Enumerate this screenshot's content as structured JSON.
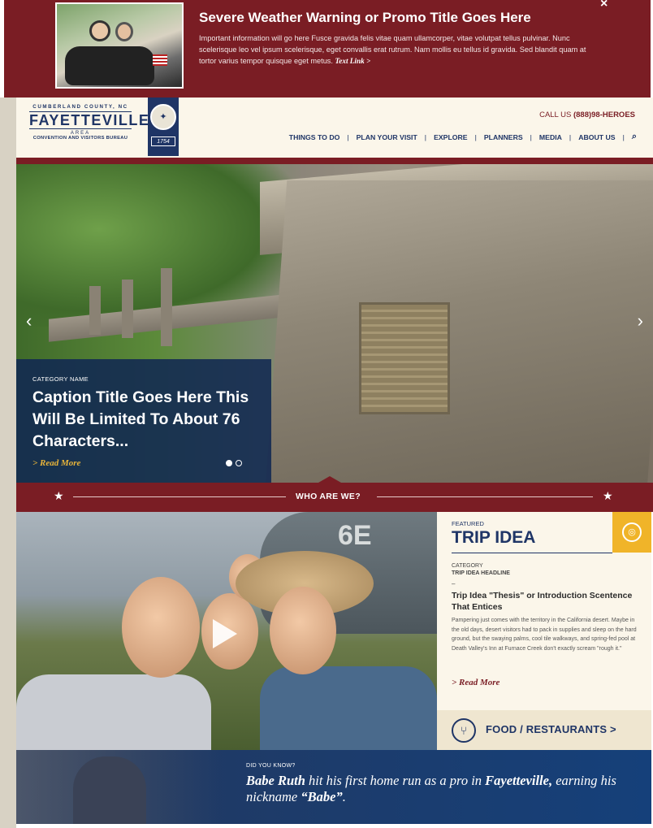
{
  "alert": {
    "title": "Severe Weather Warning or Promo Title Goes Here",
    "body": "Important information will go here Fusce gravida felis vitae quam ullamcorper, vitae volutpat tellus pulvinar. Nunc scelerisque leo vel ipsum scelerisque, eget convallis erat rutrum. Nam mollis eu tellus id gravida. Sed blandit quam at tortor varius tempor quisque eget metus.",
    "link": "Text Link >",
    "close": "×",
    "photo_icon": "motorcycle-photo"
  },
  "header": {
    "logo_top": "CUMBERLAND COUNTY, NC",
    "logo_main": "FAYETTEVILLE",
    "logo_area": "AREA",
    "logo_bottom": "CONVENTION AND VISITORS BUREAU",
    "badge_glyph": "✦",
    "badge_year": "1754",
    "call_prefix": "CALL US",
    "call_number": "(888)98-HEROES",
    "nav": [
      "THINGS TO DO",
      "PLAN YOUR VISIT",
      "EXPLORE",
      "PLANNERS",
      "MEDIA",
      "ABOUT US"
    ],
    "nav_sep": "|",
    "search_icon": "⌕"
  },
  "hero": {
    "category": "CATEGORY NAME",
    "title": "Caption Title Goes Here This Will Be Limited To About 76 Characters...",
    "read_more": "> Read More",
    "prev": "‹",
    "next": "›",
    "slide_count": 2,
    "active_slide": 1
  },
  "section": {
    "who_label": "WHO ARE WE?",
    "star": "★"
  },
  "trip": {
    "featured": "FEATURED",
    "title": "TRIP IDEA",
    "category": "CATEGORY",
    "headline": "TRIP IDEA HEADLINE",
    "dash": "–",
    "thesis": "Trip Idea \"Thesis\" or Introduction Scentence That Entices",
    "body": "Pampering just comes with the territory in the California desert. Maybe in the old days, desert visitors had to pack in supplies and sleep on the hard ground, but the swaying palms, cool tile walkways, and spring-fed pool at Death Valley's Inn at Furnace Creek don't exactly scream \"rough it.\"",
    "read_more": "> Read More",
    "icon_glyph": "◎"
  },
  "food": {
    "icon_glyph": "⑂",
    "label": "FOOD / RESTAURANTS >"
  },
  "dyk": {
    "label": "DID YOU KNOW?",
    "name": "Babe Ruth",
    "text1": " hit his first home run as a pro in ",
    "city": "Fayetteville,",
    "text2": " earning his nickname ",
    "nickname": "“Babe”",
    "end": "."
  },
  "colors": {
    "maroon": "#7a1d24",
    "navy": "#1f3566",
    "gold": "#f0b429",
    "cream": "#fbf6ea"
  }
}
